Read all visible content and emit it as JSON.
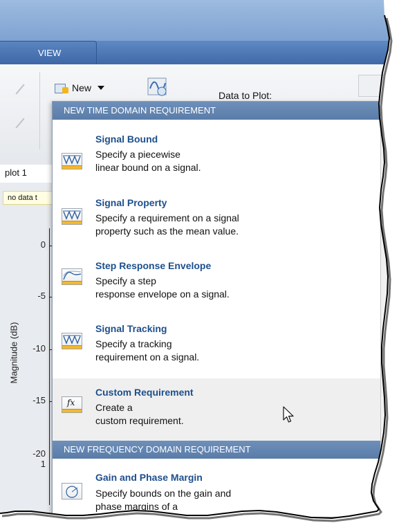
{
  "toolstrip": {
    "tabs": [
      {
        "label": "VIEW"
      }
    ],
    "new_label": "New",
    "data_to_plot_label": "Data to Plot:"
  },
  "plot": {
    "tab_label": "plot 1",
    "note": "no data t",
    "ylabel": "Magnitude (dB)",
    "yticks": [
      "0",
      "-5",
      "-10",
      "-15",
      "-20",
      "1"
    ]
  },
  "menu": {
    "time_header": "NEW TIME DOMAIN REQUIREMENT",
    "freq_header": "NEW FREQUENCY DOMAIN REQUIREMENT",
    "time_items": [
      {
        "title": "Signal Bound",
        "line1": "Specify a piecewise",
        "line2": "linear bound on a signal.",
        "icon": "signal-bound-icon"
      },
      {
        "title": "Signal Property",
        "line1": "Specify a requirement on a signal",
        "line2": "property such as the mean value.",
        "icon": "signal-property-icon"
      },
      {
        "title": "Step Response Envelope",
        "line1": "Specify a step",
        "line2": "response envelope on a signal.",
        "icon": "step-response-icon"
      },
      {
        "title": "Signal Tracking",
        "line1": "Specify a tracking",
        "line2": "requirement on a signal.",
        "icon": "signal-tracking-icon"
      },
      {
        "title": "Custom Requirement",
        "line1": "Create a",
        "line2": "custom requirement.",
        "icon": "fx-icon"
      }
    ],
    "freq_items": [
      {
        "title": "Gain and Phase Margin",
        "line1": "Specify bounds on the gain and",
        "line2": "phase margins of a",
        "icon": "gain-phase-icon"
      }
    ]
  }
}
